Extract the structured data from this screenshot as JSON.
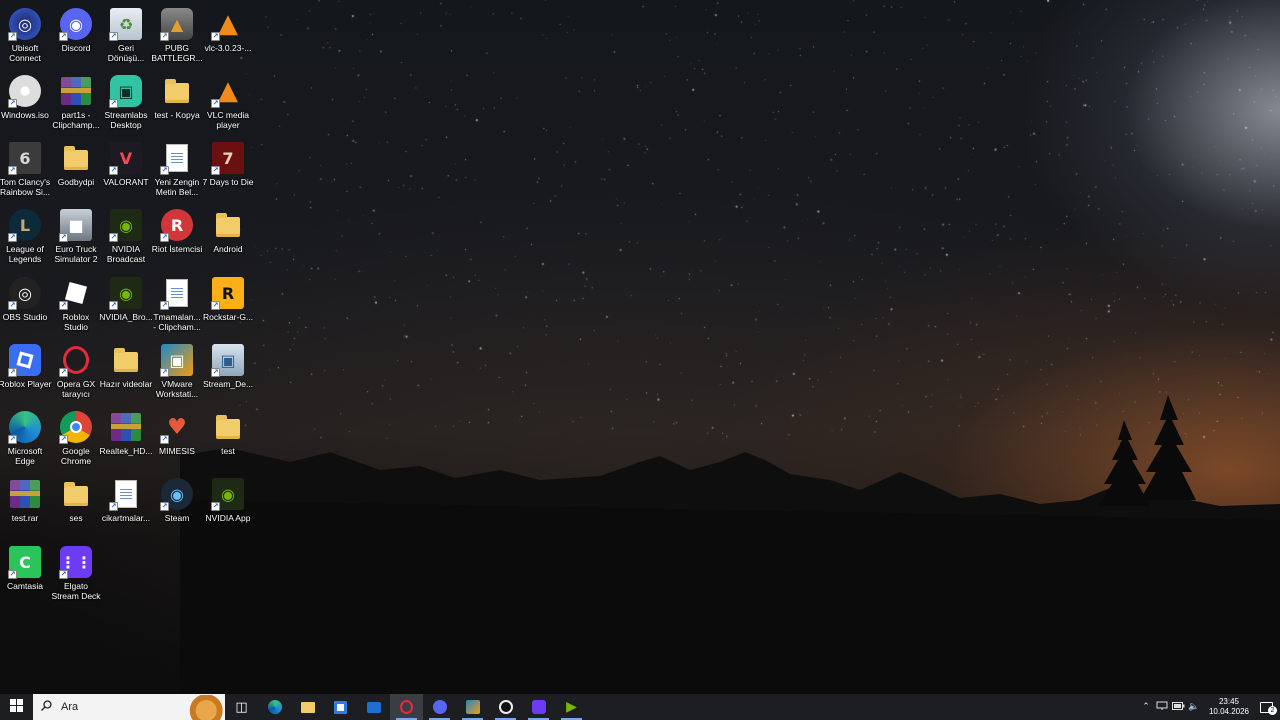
{
  "desktop": {
    "icons": [
      {
        "label": "Ubisoft\nConnect",
        "icon": "ubisoft-icon"
      },
      {
        "label": "Discord",
        "icon": "discord-icon"
      },
      {
        "label": "Geri\nDönüşü...",
        "icon": "recycle-bin-icon"
      },
      {
        "label": "PUBG\nBATTLEGR...",
        "icon": "pubg-icon"
      },
      {
        "label": "vlc-3.0.23-...",
        "icon": "vlc-installer-icon"
      },
      {
        "label": "Windows.iso",
        "icon": "disc-image-icon"
      },
      {
        "label": "part1s -\nClipchamp...",
        "icon": "winrar-archive-icon"
      },
      {
        "label": "Streamlabs\nDesktop",
        "icon": "streamlabs-icon"
      },
      {
        "label": "test - Kopya",
        "icon": "folder-icon"
      },
      {
        "label": "VLC media\nplayer",
        "icon": "vlc-icon"
      },
      {
        "label": "Tom Clancy's\nRainbow Si...",
        "icon": "rainbow-six-icon"
      },
      {
        "label": "Godbydpi",
        "icon": "folder-icon"
      },
      {
        "label": "VALORANT",
        "icon": "valorant-icon"
      },
      {
        "label": "Yeni Zengin\nMetin Bel...",
        "icon": "rich-text-document-icon"
      },
      {
        "label": "7 Days to Die",
        "icon": "seven-days-to-die-icon"
      },
      {
        "label": "League of\nLegends",
        "icon": "league-of-legends-icon"
      },
      {
        "label": "Euro Truck\nSimulator 2",
        "icon": "euro-truck-icon"
      },
      {
        "label": "NVIDIA\nBroadcast",
        "icon": "nvidia-broadcast-icon"
      },
      {
        "label": "Riot İstemcisi",
        "icon": "riot-client-icon"
      },
      {
        "label": "Android",
        "icon": "folder-icon"
      },
      {
        "label": "OBS Studio",
        "icon": "obs-icon"
      },
      {
        "label": "Roblox\nStudio",
        "icon": "roblox-studio-icon"
      },
      {
        "label": "NVIDIA_Bro...",
        "icon": "nvidia-installer-icon"
      },
      {
        "label": "Tmamalan...\n- Clipcham...",
        "icon": "video-file-icon"
      },
      {
        "label": "Rockstar-G...",
        "icon": "rockstar-icon"
      },
      {
        "label": "Roblox Player",
        "icon": "roblox-player-icon"
      },
      {
        "label": "Opera GX\ntarayıcı",
        "icon": "opera-gx-icon"
      },
      {
        "label": "Hazır videolar",
        "icon": "folder-icon"
      },
      {
        "label": "VMware\nWorkstati...",
        "icon": "vmware-icon"
      },
      {
        "label": "Stream_De...",
        "icon": "installer-icon"
      },
      {
        "label": "Microsoft\nEdge",
        "icon": "edge-icon"
      },
      {
        "label": "Google\nChrome",
        "icon": "chrome-icon"
      },
      {
        "label": "Realtek_HD...",
        "icon": "winrar-archive-icon"
      },
      {
        "label": "MIMESIS",
        "icon": "mimesis-icon"
      },
      {
        "label": "test",
        "icon": "folder-icon"
      },
      {
        "label": "test.rar",
        "icon": "winrar-archive-icon"
      },
      {
        "label": "ses",
        "icon": "folder-icon"
      },
      {
        "label": "cikartmalar...",
        "icon": "image-file-icon"
      },
      {
        "label": "Steam",
        "icon": "steam-icon"
      },
      {
        "label": "NVIDIA App",
        "icon": "nvidia-app-icon"
      },
      {
        "label": "Camtasia",
        "icon": "camtasia-icon"
      },
      {
        "label": "Elgato\nStream Deck",
        "icon": "elgato-stream-deck-icon"
      }
    ]
  },
  "taskbar": {
    "search_placeholder": "Ara",
    "pinned": [
      {
        "icon": "task-view-icon",
        "running": false
      },
      {
        "icon": "edge-icon",
        "running": false
      },
      {
        "icon": "file-explorer-icon",
        "running": false
      },
      {
        "icon": "microsoft-store-icon",
        "running": false
      },
      {
        "icon": "mail-icon",
        "running": false
      },
      {
        "icon": "opera-gx-icon",
        "running": true,
        "active": true
      },
      {
        "icon": "discord-icon",
        "running": true
      },
      {
        "icon": "vmware-icon",
        "running": true
      },
      {
        "icon": "obs-icon",
        "running": true
      },
      {
        "icon": "elgato-stream-deck-icon",
        "running": true
      },
      {
        "icon": "nvidia-broadcast-icon",
        "running": true
      }
    ],
    "tray": {
      "icons": [
        "chevron-up-icon",
        "network-icon",
        "battery-icon",
        "volume-icon"
      ],
      "time": "23:45",
      "date": "10.04.2026",
      "notification_count": "2"
    }
  },
  "colors": {
    "taskbar_bg": "#1c1e22",
    "running_indicator": "#7aa7e8"
  }
}
